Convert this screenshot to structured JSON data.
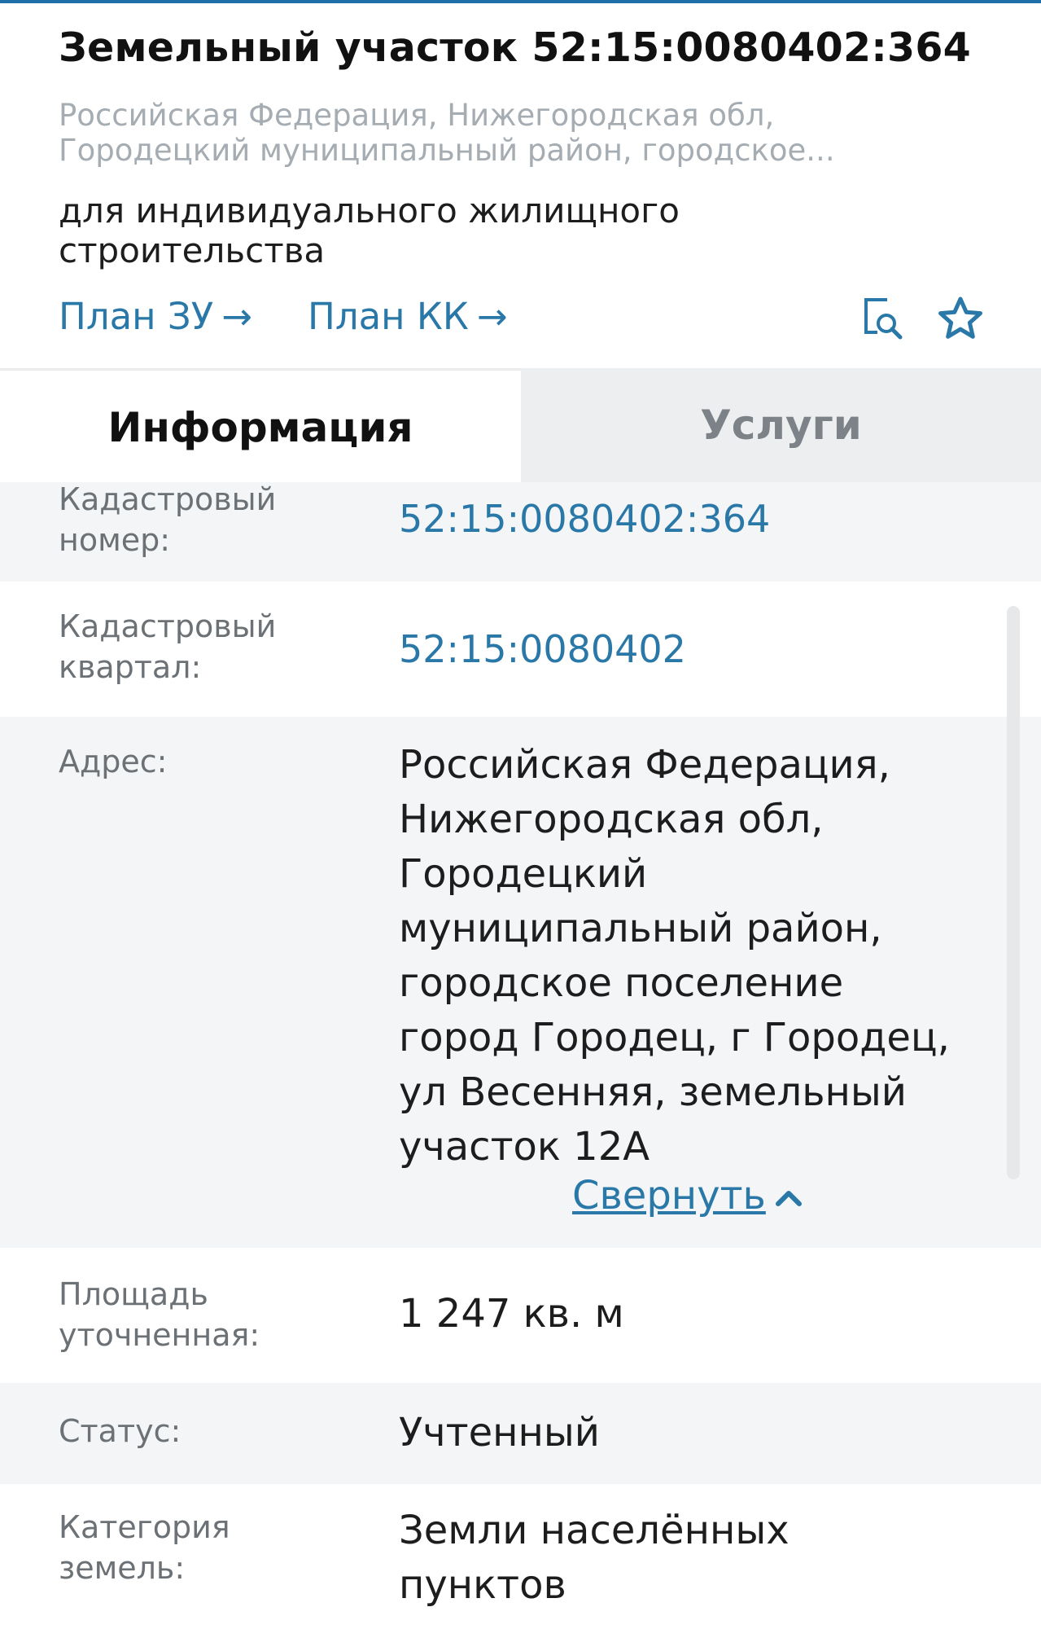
{
  "header": {
    "title": "Земельный участок 52:15:0080402:364",
    "subtitle_line1": "Российская Федерация, Нижегородская обл,",
    "subtitle_line2": "Городецкий муниципальный район, городское...",
    "purpose": "для индивидуального жилищного строительства",
    "plan_zu_label": "План ЗУ",
    "plan_kk_label": "План КК",
    "arrow_glyph": "→",
    "preview_icon": "document-search-icon",
    "favorite_icon": "star-icon",
    "accent_color": "#2a78a8"
  },
  "tabs": {
    "info": "Информация",
    "services": "Услуги",
    "active": "Информация"
  },
  "info": {
    "cadastral_number_label": "Кадастровый номер:",
    "cadastral_number_value": "52:15:0080402:364",
    "cadastral_block_label": "Кадастровый квартал:",
    "cadastral_block_value": "52:15:0080402",
    "address_label": "Адрес:",
    "address_value": "Российская Федерация, Нижегородская обл, Городецкий муниципальный район, городское поселение город Городец, г Городец, ул Весенняя, земельный участок 12А",
    "collapse_label": "Свернуть",
    "area_label": "Площадь уточненная:",
    "area_value": "1 247 кв. м",
    "status_label": "Статус:",
    "status_value": "Учтенный",
    "land_category_label": "Категория земель:",
    "land_category_value": "Земли населённых пунктов"
  }
}
